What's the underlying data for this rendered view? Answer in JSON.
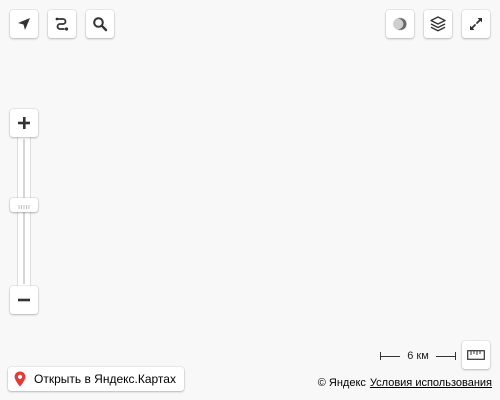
{
  "map": {
    "background_color": "#f8f8f8"
  },
  "controls": {
    "top_left": [
      {
        "icon": "location-arrow-icon"
      },
      {
        "icon": "route-icon"
      },
      {
        "icon": "search-icon"
      }
    ],
    "top_right": [
      {
        "icon": "traffic-icon"
      },
      {
        "icon": "layers-icon"
      },
      {
        "icon": "fullscreen-icon"
      }
    ],
    "zoom": {
      "in_icon": "plus-icon",
      "out_icon": "minus-icon",
      "level_fraction": 0.55
    },
    "ruler_icon": "ruler-icon"
  },
  "scale": {
    "label": "6 км"
  },
  "open_maps": {
    "label": "Открыть в Яндекс.Картах",
    "pin_color": "#e53935"
  },
  "copyright": {
    "brand": "© Яндекс",
    "terms": "Условия использования"
  }
}
